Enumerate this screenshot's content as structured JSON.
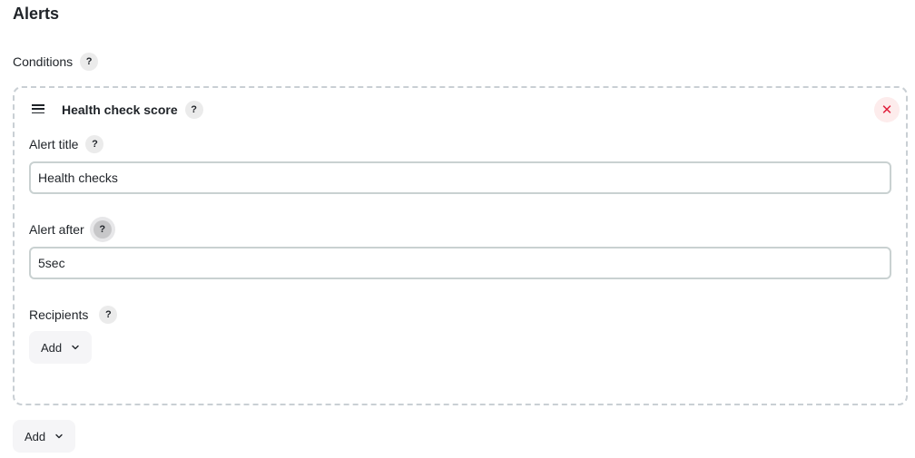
{
  "section": {
    "title": "Alerts"
  },
  "conditions": {
    "label": "Conditions",
    "help": "?"
  },
  "condition_card": {
    "title": "Health check score",
    "help": "?",
    "remove_icon": "close-icon",
    "drag_icon": "drag-handle-icon",
    "fields": {
      "alert_title": {
        "label": "Alert title",
        "help": "?",
        "value": "Health checks"
      },
      "alert_after": {
        "label": "Alert after",
        "help": "?",
        "value": "5sec"
      },
      "recipients": {
        "label": "Recipients",
        "help": "?",
        "add_label": "Add"
      }
    }
  },
  "add_condition": {
    "label": "Add"
  }
}
